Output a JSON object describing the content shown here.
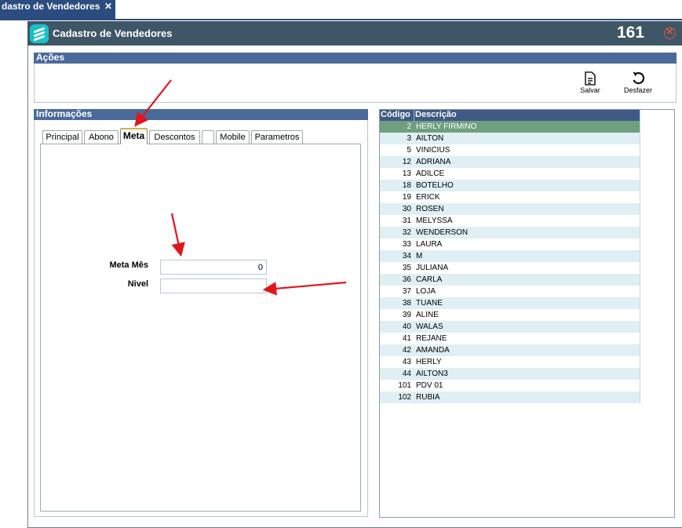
{
  "top_tab": {
    "label": "dastro de Vendedores",
    "close_glyph": "✕"
  },
  "window": {
    "title": "Cadastro de Vendedores",
    "record_id": "161",
    "close_glyph": "✕"
  },
  "acoes": {
    "header": "Ações",
    "buttons": [
      {
        "label": "Salvar",
        "icon": "save-document-icon"
      },
      {
        "label": "Desfazer",
        "icon": "undo-icon"
      }
    ]
  },
  "informacoes": {
    "header": "Informações",
    "tabs": [
      "Principal",
      "Abono",
      "Meta",
      "Descontos",
      "",
      "Mobile",
      "Parametros"
    ],
    "active_tab": "Meta",
    "fields": [
      {
        "label": "Meta Mês",
        "value": "0"
      },
      {
        "label": "Nivel",
        "value": ""
      }
    ]
  },
  "grid": {
    "columns": [
      "Código",
      "Descrição"
    ],
    "rows": [
      {
        "codigo": "2",
        "descricao": "HERLY  FIRMINO",
        "selected": true
      },
      {
        "codigo": "3",
        "descricao": "AILTON"
      },
      {
        "codigo": "5",
        "descricao": "VINICIUS"
      },
      {
        "codigo": "12",
        "descricao": "ADRIANA"
      },
      {
        "codigo": "13",
        "descricao": "ADILCE"
      },
      {
        "codigo": "18",
        "descricao": "BOTELHO"
      },
      {
        "codigo": "19",
        "descricao": "ERICK"
      },
      {
        "codigo": "30",
        "descricao": "ROSEN"
      },
      {
        "codigo": "31",
        "descricao": "MELYSSA"
      },
      {
        "codigo": "32",
        "descricao": "WENDERSON"
      },
      {
        "codigo": "33",
        "descricao": "LAURA"
      },
      {
        "codigo": "34",
        "descricao": "M"
      },
      {
        "codigo": "35",
        "descricao": "JULIANA"
      },
      {
        "codigo": "36",
        "descricao": "CARLA"
      },
      {
        "codigo": "37",
        "descricao": "LOJA"
      },
      {
        "codigo": "38",
        "descricao": "TUANE"
      },
      {
        "codigo": "39",
        "descricao": "ALINE"
      },
      {
        "codigo": "40",
        "descricao": "WALAS"
      },
      {
        "codigo": "41",
        "descricao": "REJANE"
      },
      {
        "codigo": "42",
        "descricao": "AMANDA"
      },
      {
        "codigo": "43",
        "descricao": "HERLY"
      },
      {
        "codigo": "44",
        "descricao": "AILTON3"
      },
      {
        "codigo": "101",
        "descricao": "PDV 01"
      },
      {
        "codigo": "102",
        "descricao": "RUBIA"
      }
    ]
  },
  "colors": {
    "titlebar": "#3f5666",
    "section_header": "#4a6a9a",
    "selected_row": "#6f9f80",
    "alt_row": "#dfeff4",
    "annotation_arrow": "#e3151a"
  }
}
